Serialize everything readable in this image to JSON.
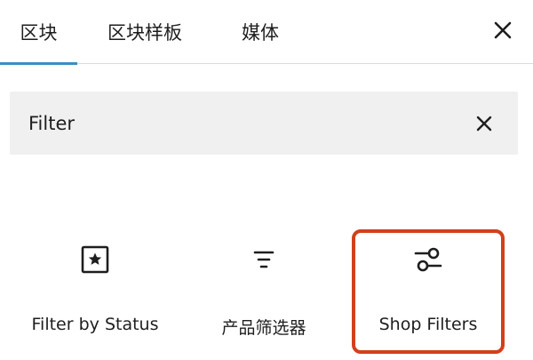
{
  "tabs": [
    {
      "label": "区块",
      "active": true
    },
    {
      "label": "区块样板",
      "active": false
    },
    {
      "label": "媒体",
      "active": false
    }
  ],
  "search": {
    "value": "Filter"
  },
  "results": [
    {
      "label": "Filter by Status",
      "icon": "star-box-icon"
    },
    {
      "label": "产品筛选器",
      "icon": "filter-lines-icon"
    },
    {
      "label": "Shop Filters",
      "icon": "sliders-icon",
      "highlighted": true
    }
  ],
  "colors": {
    "accent": "#3c8dbf",
    "highlight": "#d2401c",
    "search_bg": "#f0f0f0",
    "text": "#1e1e1e"
  }
}
